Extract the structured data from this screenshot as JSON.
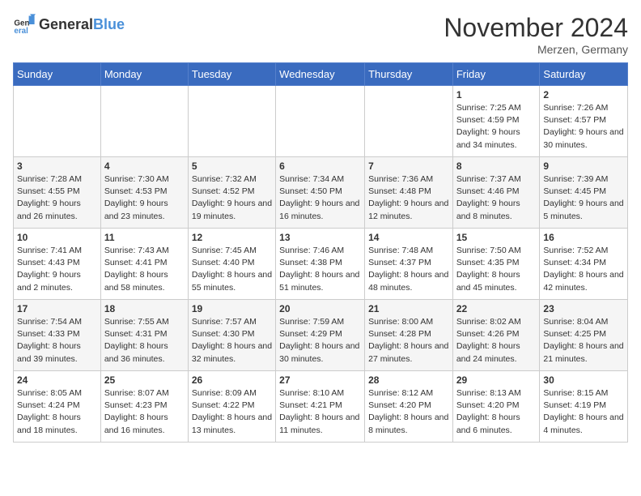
{
  "header": {
    "logo_general": "General",
    "logo_blue": "Blue",
    "month_title": "November 2024",
    "location": "Merzen, Germany"
  },
  "days_of_week": [
    "Sunday",
    "Monday",
    "Tuesday",
    "Wednesday",
    "Thursday",
    "Friday",
    "Saturday"
  ],
  "weeks": [
    [
      {
        "day": "",
        "info": ""
      },
      {
        "day": "",
        "info": ""
      },
      {
        "day": "",
        "info": ""
      },
      {
        "day": "",
        "info": ""
      },
      {
        "day": "",
        "info": ""
      },
      {
        "day": "1",
        "info": "Sunrise: 7:25 AM\nSunset: 4:59 PM\nDaylight: 9 hours and 34 minutes."
      },
      {
        "day": "2",
        "info": "Sunrise: 7:26 AM\nSunset: 4:57 PM\nDaylight: 9 hours and 30 minutes."
      }
    ],
    [
      {
        "day": "3",
        "info": "Sunrise: 7:28 AM\nSunset: 4:55 PM\nDaylight: 9 hours and 26 minutes."
      },
      {
        "day": "4",
        "info": "Sunrise: 7:30 AM\nSunset: 4:53 PM\nDaylight: 9 hours and 23 minutes."
      },
      {
        "day": "5",
        "info": "Sunrise: 7:32 AM\nSunset: 4:52 PM\nDaylight: 9 hours and 19 minutes."
      },
      {
        "day": "6",
        "info": "Sunrise: 7:34 AM\nSunset: 4:50 PM\nDaylight: 9 hours and 16 minutes."
      },
      {
        "day": "7",
        "info": "Sunrise: 7:36 AM\nSunset: 4:48 PM\nDaylight: 9 hours and 12 minutes."
      },
      {
        "day": "8",
        "info": "Sunrise: 7:37 AM\nSunset: 4:46 PM\nDaylight: 9 hours and 8 minutes."
      },
      {
        "day": "9",
        "info": "Sunrise: 7:39 AM\nSunset: 4:45 PM\nDaylight: 9 hours and 5 minutes."
      }
    ],
    [
      {
        "day": "10",
        "info": "Sunrise: 7:41 AM\nSunset: 4:43 PM\nDaylight: 9 hours and 2 minutes."
      },
      {
        "day": "11",
        "info": "Sunrise: 7:43 AM\nSunset: 4:41 PM\nDaylight: 8 hours and 58 minutes."
      },
      {
        "day": "12",
        "info": "Sunrise: 7:45 AM\nSunset: 4:40 PM\nDaylight: 8 hours and 55 minutes."
      },
      {
        "day": "13",
        "info": "Sunrise: 7:46 AM\nSunset: 4:38 PM\nDaylight: 8 hours and 51 minutes."
      },
      {
        "day": "14",
        "info": "Sunrise: 7:48 AM\nSunset: 4:37 PM\nDaylight: 8 hours and 48 minutes."
      },
      {
        "day": "15",
        "info": "Sunrise: 7:50 AM\nSunset: 4:35 PM\nDaylight: 8 hours and 45 minutes."
      },
      {
        "day": "16",
        "info": "Sunrise: 7:52 AM\nSunset: 4:34 PM\nDaylight: 8 hours and 42 minutes."
      }
    ],
    [
      {
        "day": "17",
        "info": "Sunrise: 7:54 AM\nSunset: 4:33 PM\nDaylight: 8 hours and 39 minutes."
      },
      {
        "day": "18",
        "info": "Sunrise: 7:55 AM\nSunset: 4:31 PM\nDaylight: 8 hours and 36 minutes."
      },
      {
        "day": "19",
        "info": "Sunrise: 7:57 AM\nSunset: 4:30 PM\nDaylight: 8 hours and 32 minutes."
      },
      {
        "day": "20",
        "info": "Sunrise: 7:59 AM\nSunset: 4:29 PM\nDaylight: 8 hours and 30 minutes."
      },
      {
        "day": "21",
        "info": "Sunrise: 8:00 AM\nSunset: 4:28 PM\nDaylight: 8 hours and 27 minutes."
      },
      {
        "day": "22",
        "info": "Sunrise: 8:02 AM\nSunset: 4:26 PM\nDaylight: 8 hours and 24 minutes."
      },
      {
        "day": "23",
        "info": "Sunrise: 8:04 AM\nSunset: 4:25 PM\nDaylight: 8 hours and 21 minutes."
      }
    ],
    [
      {
        "day": "24",
        "info": "Sunrise: 8:05 AM\nSunset: 4:24 PM\nDaylight: 8 hours and 18 minutes."
      },
      {
        "day": "25",
        "info": "Sunrise: 8:07 AM\nSunset: 4:23 PM\nDaylight: 8 hours and 16 minutes."
      },
      {
        "day": "26",
        "info": "Sunrise: 8:09 AM\nSunset: 4:22 PM\nDaylight: 8 hours and 13 minutes."
      },
      {
        "day": "27",
        "info": "Sunrise: 8:10 AM\nSunset: 4:21 PM\nDaylight: 8 hours and 11 minutes."
      },
      {
        "day": "28",
        "info": "Sunrise: 8:12 AM\nSunset: 4:20 PM\nDaylight: 8 hours and 8 minutes."
      },
      {
        "day": "29",
        "info": "Sunrise: 8:13 AM\nSunset: 4:20 PM\nDaylight: 8 hours and 6 minutes."
      },
      {
        "day": "30",
        "info": "Sunrise: 8:15 AM\nSunset: 4:19 PM\nDaylight: 8 hours and 4 minutes."
      }
    ]
  ]
}
